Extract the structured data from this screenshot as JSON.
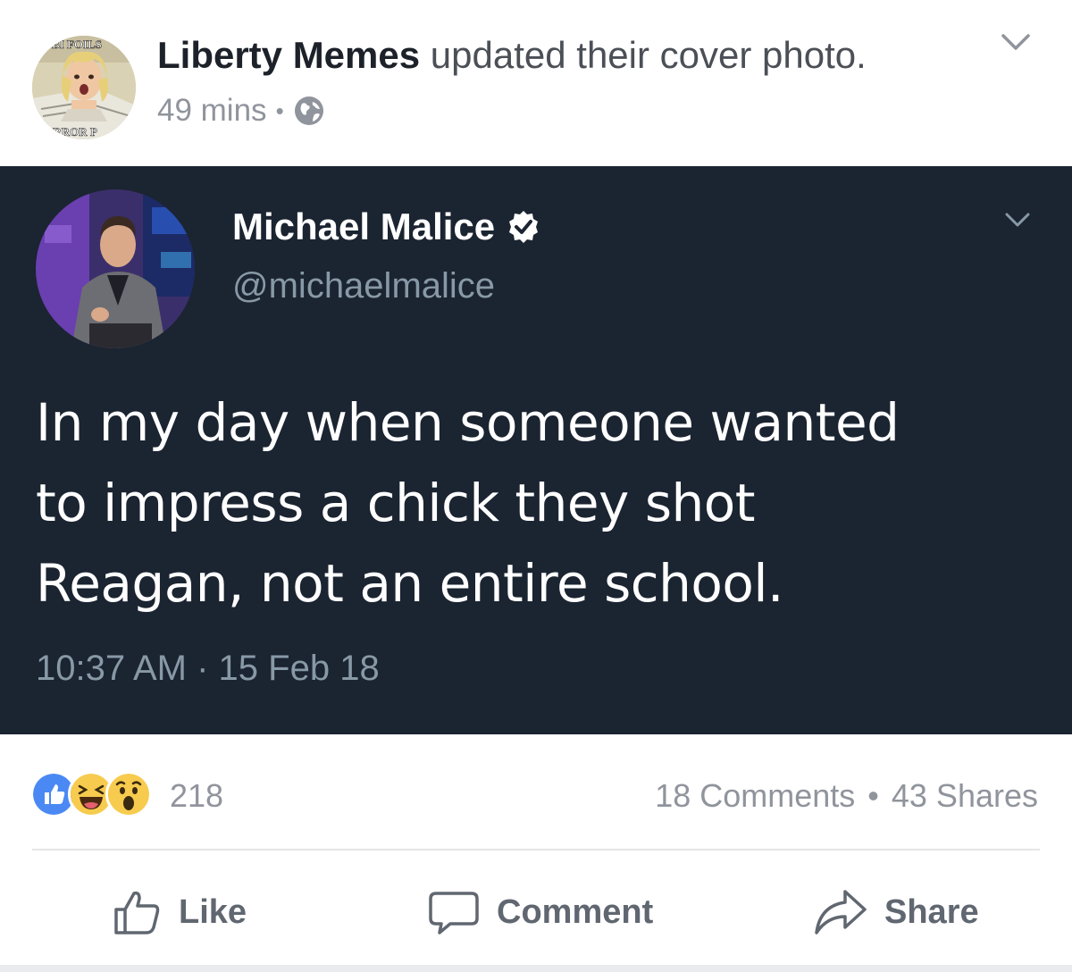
{
  "post_header": {
    "page_name": "Liberty Memes",
    "action_text": "updated their cover photo.",
    "time_ago": "49 mins",
    "separator": "•",
    "privacy_icon": "globe-icon",
    "avatar_caption_top": "FBI FOILS",
    "avatar_caption_bottom": "TERROR P"
  },
  "tweet": {
    "author_name": "Michael Malice",
    "verified": true,
    "handle": "@michaelmalice",
    "text": "In my day when someone wanted\nto impress a chick they shot\nReagan, not an entire school.",
    "timestamp": "10:37 AM · 15 Feb 18",
    "background_color": "#1b2431"
  },
  "reactions": {
    "icons": [
      "like-reaction-icon",
      "haha-reaction-icon",
      "wow-reaction-icon"
    ],
    "count": "218",
    "comments": "18 Comments",
    "separator": "•",
    "shares": "43 Shares"
  },
  "actions": {
    "like_label": "Like",
    "comment_label": "Comment",
    "share_label": "Share"
  },
  "colors": {
    "facebook_blue": "#4267b2",
    "text_dark": "#1d2129",
    "text_muted": "#90949c",
    "tweet_bg": "#1b2431",
    "verified_bg": "#ffffff"
  }
}
